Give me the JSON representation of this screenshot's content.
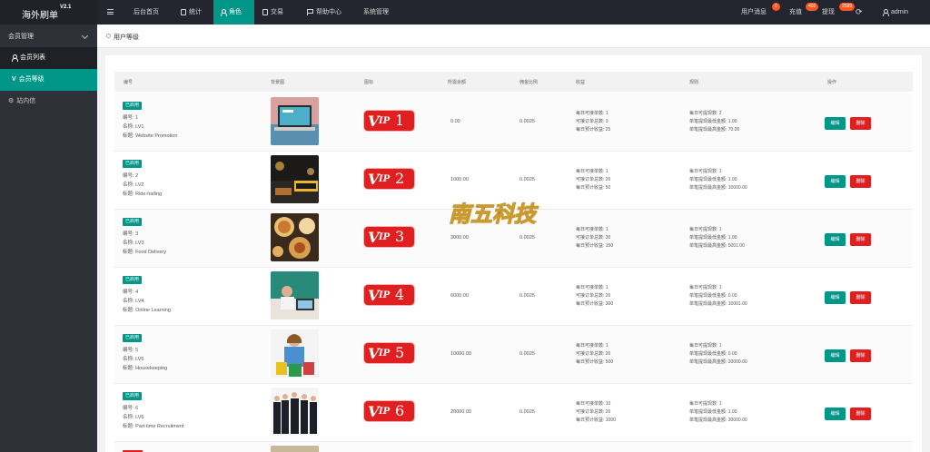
{
  "brand": {
    "name": "海外刷单",
    "version": "V2.1"
  },
  "nav": {
    "items": [
      {
        "label": "后台首页"
      },
      {
        "label": "统计"
      },
      {
        "label": "角色"
      },
      {
        "label": "交易"
      },
      {
        "label": "帮助中心"
      },
      {
        "label": "系统管理"
      }
    ],
    "right": {
      "messages": "用户消息",
      "messages_badge": "0",
      "recharge": "充值",
      "recharge_badge": "402",
      "withdraw": "提现",
      "withdraw_badge": "2589",
      "user": "admin"
    }
  },
  "sidebar": {
    "group": "会员管理",
    "sub1": "会员列表",
    "sub2": "会员等级",
    "item": "站内信"
  },
  "breadcrumb": "用户等级",
  "table": {
    "headers": [
      "编号",
      "背景图",
      "图标",
      "所需余额",
      "佣金比例",
      "收益",
      "规则",
      "操作"
    ],
    "tag": "已启用",
    "field_id": "编号:",
    "field_name": "名称:",
    "field_title": "标题:",
    "income_labels": [
      "每日可接单数:",
      "可接订单总数:",
      "每日预计收益:"
    ],
    "rule_labels": [
      "每日可提现数:",
      "单笔提现最低金额:",
      "单笔提现最高金额:"
    ],
    "edit_label": "编辑",
    "delete_label": "删除",
    "rows": [
      {
        "id": "1",
        "name": "LV1",
        "title": "Website Promotion",
        "vip": "1",
        "balance": "0.00",
        "rate": "0.0025",
        "inc": [
          "1",
          "3",
          "25"
        ],
        "rule": [
          "2",
          "1.00",
          "70.00"
        ]
      },
      {
        "id": "2",
        "name": "LV2",
        "title": "Ride-hailing",
        "vip": "2",
        "balance": "1000.00",
        "rate": "0.0025",
        "inc": [
          "1",
          "20",
          "50"
        ],
        "rule": [
          "1",
          "1.00",
          "10000.00"
        ]
      },
      {
        "id": "3",
        "name": "LV3",
        "title": "Food Delivery",
        "vip": "3",
        "balance": "3000.00",
        "rate": "0.0025",
        "inc": [
          "1",
          "30",
          "150"
        ],
        "rule": [
          "1",
          "1.00",
          "5001.00"
        ]
      },
      {
        "id": "4",
        "name": "LV4",
        "title": "Online Learning",
        "vip": "4",
        "balance": "6000.00",
        "rate": "0.0025",
        "inc": [
          "1",
          "20",
          "300"
        ],
        "rule": [
          "1",
          "0.00",
          "10001.00"
        ]
      },
      {
        "id": "5",
        "name": "LV5",
        "title": "Housekeeping",
        "vip": "5",
        "balance": "10000.00",
        "rate": "0.0025",
        "inc": [
          "1",
          "20",
          "500"
        ],
        "rule": [
          "1",
          "0.00",
          "20000.00"
        ]
      },
      {
        "id": "6",
        "name": "LV6",
        "title": "Part-time Recruitment",
        "vip": "6",
        "balance": "20000.00",
        "rate": "0.0025",
        "inc": [
          "10",
          "20",
          "1000"
        ],
        "rule": [
          "1",
          "1.00",
          "30000.00"
        ]
      }
    ]
  },
  "watermark": "南五科技",
  "colors": {
    "accent": "#009688",
    "danger": "#e02020",
    "topbar": "#23262e",
    "sidebar": "#2f3138"
  }
}
